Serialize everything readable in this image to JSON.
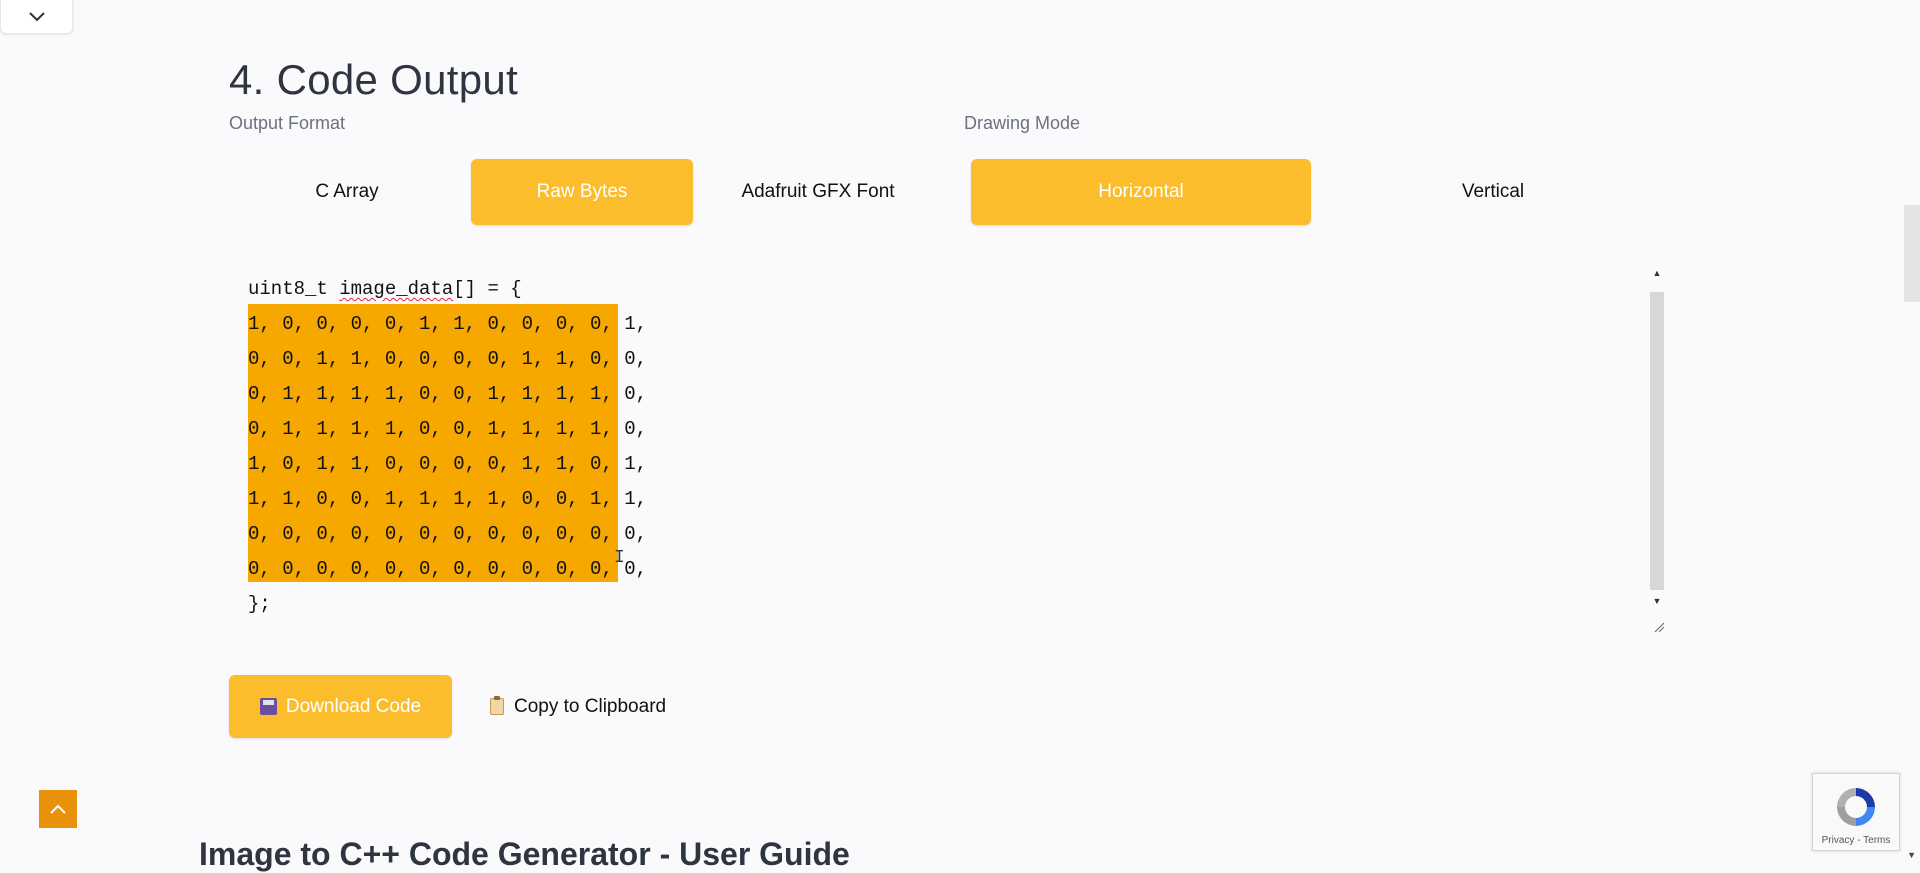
{
  "section": {
    "title": "4. Code Output"
  },
  "output_format": {
    "label": "Output Format",
    "options": [
      "C Array",
      "Raw Bytes",
      "Adafruit GFX Font"
    ],
    "selected": "Raw Bytes"
  },
  "drawing_mode": {
    "label": "Drawing Mode",
    "options": [
      "Horizontal",
      "Vertical"
    ],
    "selected": "Horizontal"
  },
  "code": {
    "declaration_type": "uint8_t ",
    "declaration_name": "image_data",
    "declaration_rest": "[] = {",
    "rows": [
      "1, 0, 0, 0, 0, 1, 1, 0, 0, 0, 0, 1,",
      "0, 0, 1, 1, 0, 0, 0, 0, 1, 1, 0, 0,",
      "0, 1, 1, 1, 1, 0, 0, 1, 1, 1, 1, 0,",
      "0, 1, 1, 1, 1, 0, 0, 1, 1, 1, 1, 0,",
      "1, 0, 1, 1, 0, 0, 0, 0, 1, 1, 0, 1,",
      "1, 1, 0, 0, 1, 1, 1, 1, 0, 0, 1, 1,",
      "0, 0, 0, 0, 0, 0, 0, 0, 0, 0, 0, 0,",
      "0, 0, 0, 0, 0, 0, 0, 0, 0, 0, 0, 0,"
    ],
    "closing": "};"
  },
  "actions": {
    "download_label": "Download Code",
    "copy_label": "Copy to Clipboard"
  },
  "guide": {
    "title": "Image to C++ Code Generator - User Guide"
  },
  "recaptcha": {
    "terms": "Privacy - Terms"
  },
  "colors": {
    "accent": "#fbbd2b",
    "selection": "#f6a800",
    "back_to_top": "#e8910a"
  },
  "icons": {
    "collapse": "chevron-down-icon",
    "back_to_top": "chevron-up-icon",
    "download": "floppy-disk-icon",
    "copy": "clipboard-icon"
  }
}
